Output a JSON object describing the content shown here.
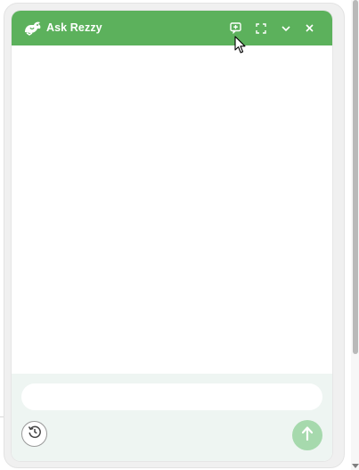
{
  "header": {
    "title": "Ask Rezzy",
    "logo_icon": "rezzy-logo-icon",
    "buttons": [
      {
        "name": "new-chat",
        "icon": "new-chat-icon"
      },
      {
        "name": "expand",
        "icon": "expand-icon"
      },
      {
        "name": "minimize",
        "icon": "chevron-down-icon"
      },
      {
        "name": "close",
        "icon": "close-icon"
      }
    ],
    "color": "#5cb15c"
  },
  "composer": {
    "input_value": "",
    "input_placeholder": "",
    "history_icon": "history-icon",
    "send_icon": "arrow-up-icon",
    "send_color": "#a6d9ad",
    "background": "#eef5f2"
  }
}
